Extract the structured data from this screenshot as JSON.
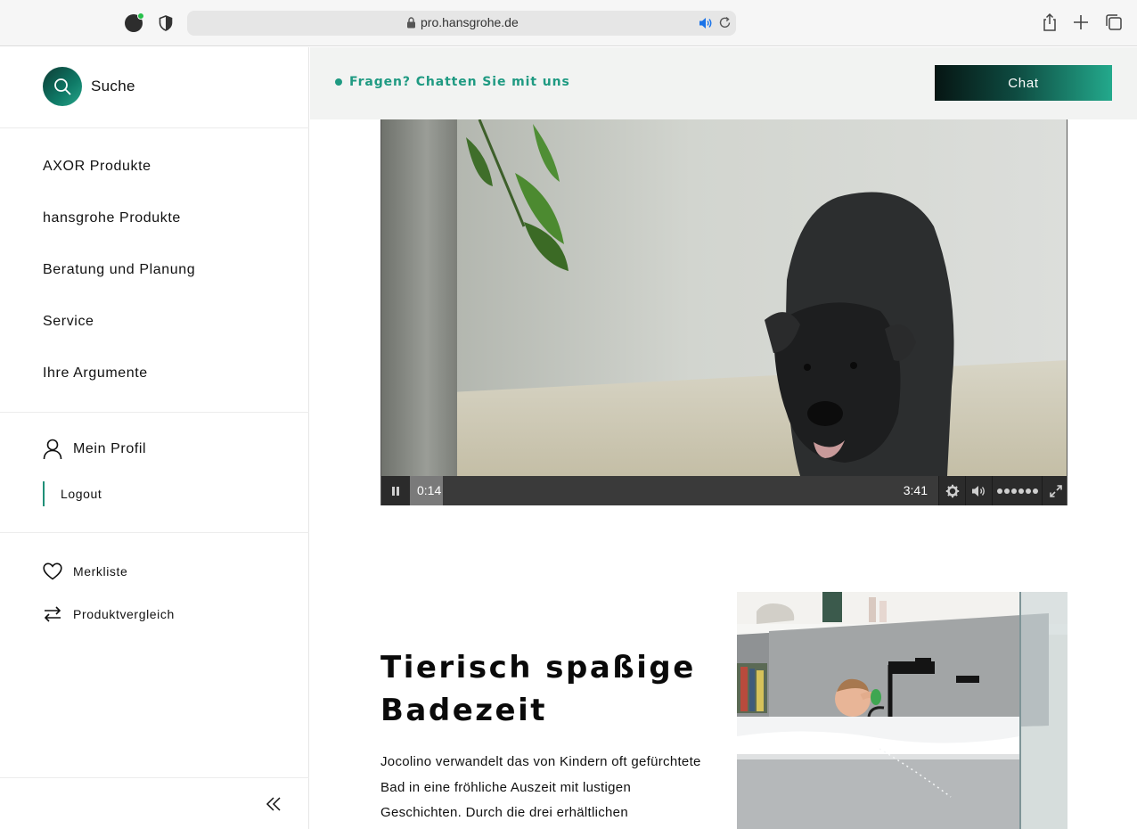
{
  "browser": {
    "url": "pro.hansgrohe.de"
  },
  "sidebar": {
    "search_label": "Suche",
    "nav_items": [
      {
        "label": "AXOR Produkte"
      },
      {
        "label": "hansgrohe Produkte"
      },
      {
        "label": "Beratung und Planung"
      },
      {
        "label": "Service"
      },
      {
        "label": "Ihre Argumente"
      }
    ],
    "profile_label": "Mein Profil",
    "logout_label": "Logout",
    "wishlist_label": "Merkliste",
    "compare_label": "Produktvergleich"
  },
  "topbar": {
    "chat_prompt": "Fragen? Chatten Sie mit uns",
    "chat_button": "Chat"
  },
  "video": {
    "current_time": "0:14",
    "total_time": "3:41",
    "progress_fraction": 0.063
  },
  "article": {
    "headline": "Tierisch spaßige Badezeit",
    "body": "Jocolino verwandelt das von Kindern oft gefürchtete Bad in eine fröhliche Auszeit mit lustigen Geschichten. Durch die drei erhältlichen"
  },
  "colors": {
    "accent": "#1f9a82",
    "chat_gradient_start": "#061513",
    "chat_gradient_end": "#23a98c"
  }
}
